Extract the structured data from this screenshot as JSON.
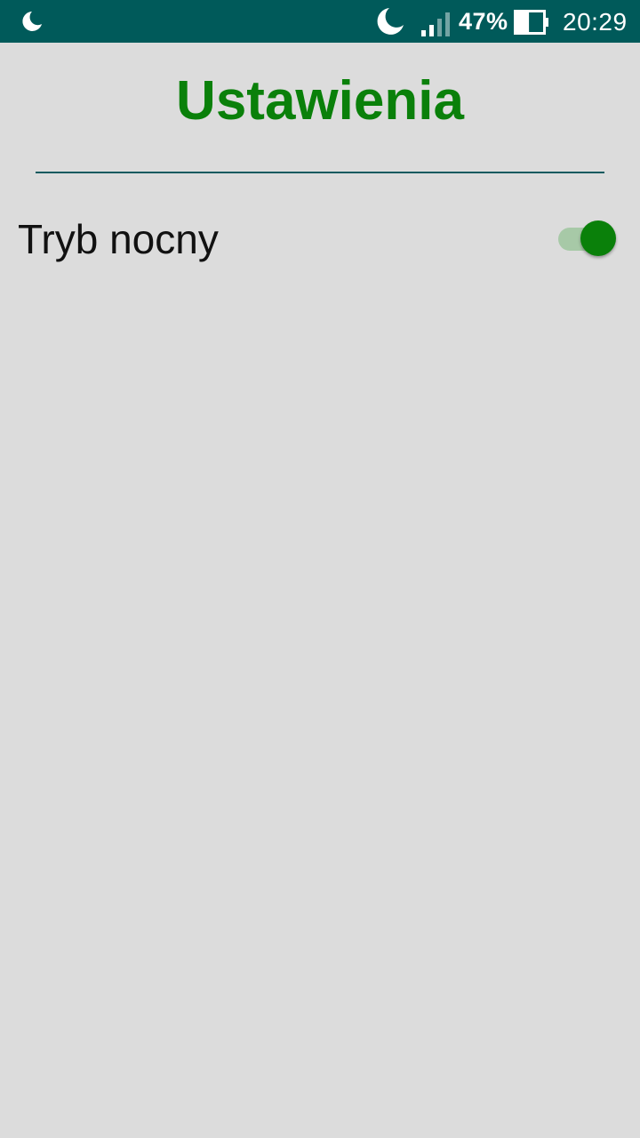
{
  "status_bar": {
    "left_icon": "moon-icon",
    "dnd_icon": "moon-icon",
    "signal_icon": "cellular-signal-icon",
    "battery_percent": "47%",
    "battery_icon": "battery-icon",
    "battery_level": 0.47,
    "time": "20:29"
  },
  "page": {
    "title": "Ustawienia"
  },
  "settings": {
    "night_mode": {
      "label": "Tryb nocny",
      "enabled": true
    }
  },
  "colors": {
    "status_bar": "#005a5a",
    "accent_green": "#0a800a",
    "background": "#dcdcdc",
    "toggle_track_on": "#a7c9a7",
    "divider": "#0f5a5f"
  }
}
